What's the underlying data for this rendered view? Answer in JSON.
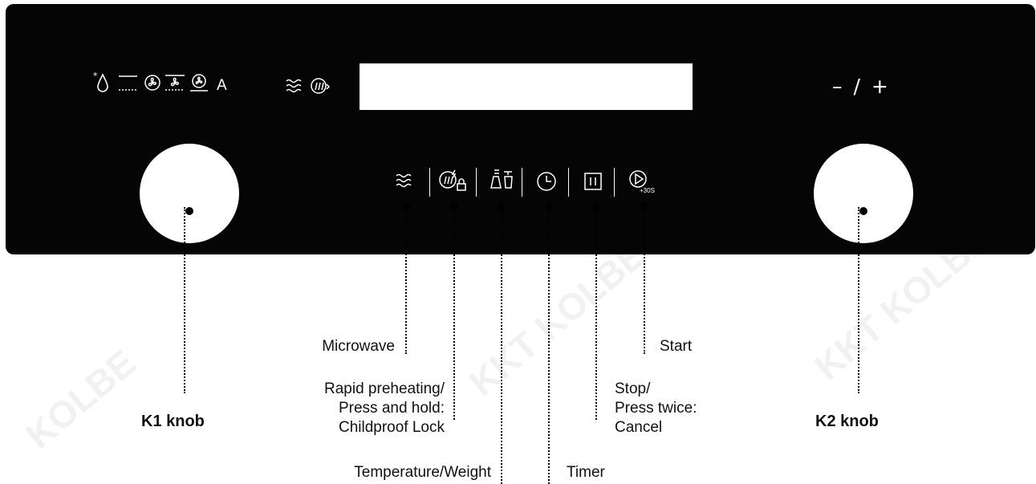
{
  "panel": {
    "mode_a_label": "A",
    "plus_minus": "– / +"
  },
  "labels": {
    "k1": "K1 knob",
    "k2": "K2 knob",
    "microwave": "Microwave",
    "rapid": [
      "Rapid preheating/",
      "Press and hold:",
      "Childproof Lock"
    ],
    "temperature": "Temperature/Weight",
    "timer": "Timer",
    "stop": [
      "Stop/",
      "Press twice:",
      "Cancel"
    ],
    "start": "Start"
  },
  "icons": {
    "start_badge": "+30S"
  },
  "colors": {
    "panel": "#050505",
    "display": "#ffffff",
    "knob": "#ffffff",
    "icon": "#ffffff",
    "text": "#111111"
  }
}
